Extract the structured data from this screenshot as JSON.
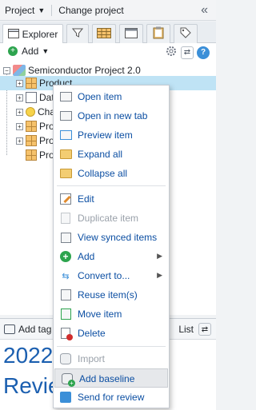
{
  "topbar": {
    "project_label": "Project",
    "change_project_label": "Change project",
    "collapse_icon": "double-chevron-left-icon"
  },
  "tabs": [
    {
      "label": "Explorer",
      "icon": "explorer-icon",
      "active": true
    },
    {
      "label": "",
      "icon": "filter-icon"
    },
    {
      "label": "",
      "icon": "table-icon"
    },
    {
      "label": "",
      "icon": "window-icon"
    },
    {
      "label": "",
      "icon": "clipboard-icon"
    },
    {
      "label": "",
      "icon": "tag-icon"
    }
  ],
  "toolbar": {
    "add_label": "Add",
    "icons": [
      "gear-icon",
      "sync-icon",
      "info-icon"
    ]
  },
  "tree": {
    "root_label": "Semiconductor Project 2.0",
    "rows": [
      {
        "label": "Product",
        "icon": "grid-icon",
        "selected": true
      },
      {
        "label": "Dat",
        "icon": "document-icon"
      },
      {
        "label": "Cha",
        "icon": "bulb-icon"
      },
      {
        "label": "Pro",
        "icon": "grid-icon"
      },
      {
        "label": "Pro",
        "icon": "grid-icon"
      },
      {
        "label": "Pro",
        "icon": "grid-icon"
      }
    ]
  },
  "bottom": {
    "add_tag_label": "Add tag",
    "list_label": "List",
    "big_text_1": "2022",
    "big_text_2": "Revie"
  },
  "context_menu": {
    "items": [
      {
        "label": "Open item",
        "icon": "open-item-icon",
        "disabled": false
      },
      {
        "label": "Open in new tab",
        "icon": "open-new-tab-icon",
        "disabled": false
      },
      {
        "label": "Preview item",
        "icon": "preview-icon",
        "disabled": false
      },
      {
        "label": "Expand all",
        "icon": "expand-folder-icon",
        "disabled": false
      },
      {
        "label": "Collapse all",
        "icon": "collapse-folder-icon",
        "disabled": false
      },
      {
        "label": "Edit",
        "icon": "edit-icon",
        "disabled": false
      },
      {
        "label": "Duplicate item",
        "icon": "duplicate-icon",
        "disabled": true
      },
      {
        "label": "View synced items",
        "icon": "synced-items-icon",
        "disabled": false
      },
      {
        "label": "Add",
        "icon": "add-icon",
        "disabled": false,
        "submenu": true
      },
      {
        "label": "Convert to...",
        "icon": "convert-icon",
        "disabled": false,
        "submenu": true
      },
      {
        "label": "Reuse item(s)",
        "icon": "reuse-icon",
        "disabled": false
      },
      {
        "label": "Move item",
        "icon": "move-icon",
        "disabled": false
      },
      {
        "label": "Delete",
        "icon": "delete-icon",
        "disabled": false
      },
      {
        "label": "Import",
        "icon": "import-icon",
        "disabled": true
      },
      {
        "label": "Add baseline",
        "icon": "add-baseline-icon",
        "disabled": false,
        "hover": true
      },
      {
        "label": "Send for review",
        "icon": "send-review-icon",
        "disabled": false
      }
    ]
  }
}
